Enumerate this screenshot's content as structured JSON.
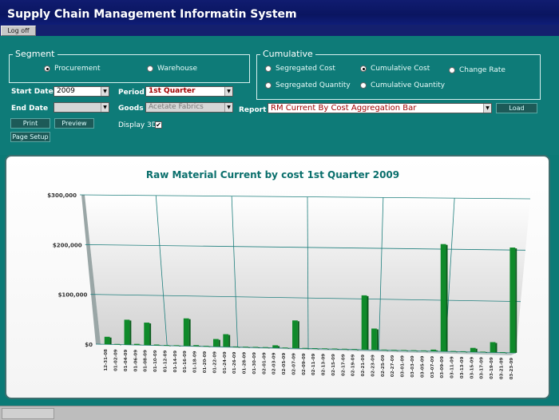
{
  "window": {
    "title": "Supply Chain Management Informatin System",
    "logoff_label": "Log off"
  },
  "segment": {
    "legend": "Segment",
    "options": [
      {
        "label": "Procurement",
        "selected": true
      },
      {
        "label": "Warehouse",
        "selected": false
      }
    ]
  },
  "cumulative": {
    "legend": "Cumulative",
    "options": [
      {
        "label": "Segregated Cost",
        "selected": false
      },
      {
        "label": "Cumulative Cost",
        "selected": true
      },
      {
        "label": "Change Rate",
        "selected": false
      },
      {
        "label": "Segregated Quantity",
        "selected": false
      },
      {
        "label": "Cumulative Quantity",
        "selected": false
      }
    ]
  },
  "filters": {
    "start_date_label": "Start Date",
    "start_date_value": "2009",
    "end_date_label": "End Date",
    "end_date_value": "",
    "period_label": "Period",
    "period_value": "1st Quarter",
    "goods_label": "Goods",
    "goods_value": "Acetate Fabrics",
    "report_label": "Report",
    "report_value": "RM Current By Cost Aggregation Bar",
    "display3d_label": "Display 3D",
    "display3d_checked": true
  },
  "buttons": {
    "print": "Print",
    "preview": "Preview",
    "page_setup": "Page Setup",
    "load": "Load"
  },
  "colors": {
    "bar": "#0f8a2a",
    "grid": "#1f7f7d",
    "title": "#0a6f6c"
  },
  "chart_data": {
    "type": "bar",
    "title": "Raw Material Current by cost 1st Quarter 2009",
    "ylim": [
      0,
      300000
    ],
    "yticks": [
      "$0",
      "$100,000",
      "$200,000",
      "$300,000"
    ],
    "categories": [
      "12-31-08",
      "01-02-09",
      "01-04-09",
      "01-06-09",
      "01-08-09",
      "01-10-09",
      "01-12-09",
      "01-14-09",
      "01-16-09",
      "01-18-09",
      "01-20-09",
      "01-22-09",
      "01-24-09",
      "01-26-09",
      "01-28-09",
      "01-30-09",
      "02-01-09",
      "02-03-09",
      "02-05-09",
      "02-07-09",
      "02-09-09",
      "02-11-09",
      "02-13-09",
      "02-15-09",
      "02-17-09",
      "02-19-09",
      "02-21-09",
      "02-23-09",
      "02-25-09",
      "02-27-09",
      "03-01-09",
      "03-03-09",
      "03-05-09",
      "03-07-09",
      "03-09-09",
      "03-11-09",
      "03-13-09",
      "03-15-09",
      "03-17-09",
      "03-19-09",
      "03-21-09",
      "03-23-09"
    ],
    "values": [
      15000,
      1000,
      50000,
      2000,
      45000,
      1500,
      1000,
      1000,
      55000,
      2000,
      1000,
      15000,
      25000,
      1000,
      1000,
      1000,
      1000,
      5000,
      1000,
      55000,
      1000,
      1000,
      1000,
      1000,
      1000,
      1000,
      107000,
      42000,
      1000,
      1000,
      1000,
      1000,
      1000,
      3000,
      210000,
      1000,
      1000,
      8000,
      1000,
      20000,
      1000,
      205000
    ],
    "grid": true,
    "view": "3d"
  }
}
